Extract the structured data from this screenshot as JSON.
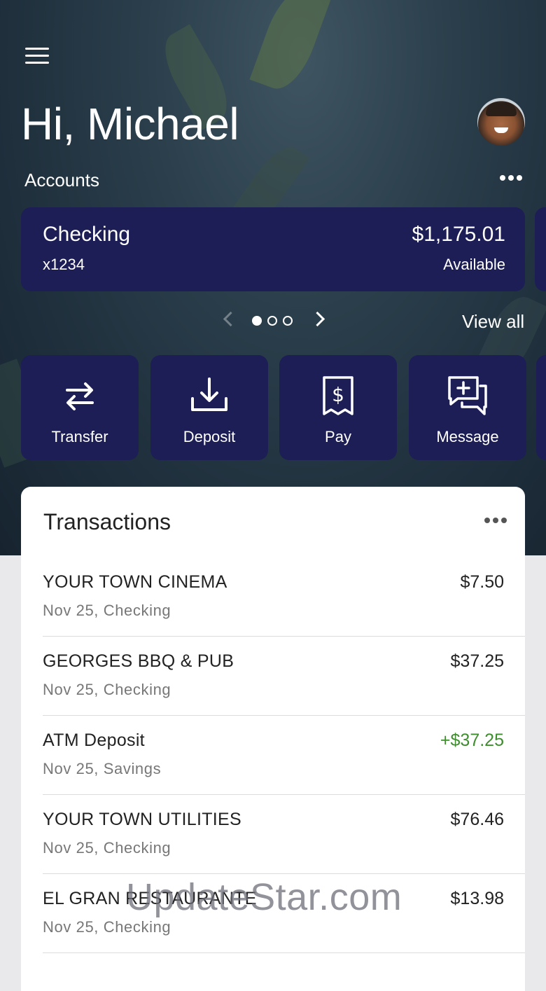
{
  "header": {
    "greeting": "Hi, Michael",
    "accounts_label": "Accounts"
  },
  "account_card": {
    "name": "Checking",
    "number": "x1234",
    "balance": "$1,175.01",
    "balance_label": "Available"
  },
  "pager": {
    "view_all": "View all",
    "pages": 3,
    "active_page": 1
  },
  "actions": [
    {
      "label": "Transfer",
      "icon": "transfer-arrows-icon"
    },
    {
      "label": "Deposit",
      "icon": "download-tray-icon"
    },
    {
      "label": "Pay",
      "icon": "dollar-receipt-icon"
    },
    {
      "label": "Message",
      "icon": "message-plus-icon"
    }
  ],
  "transactions": {
    "title": "Transactions",
    "items": [
      {
        "name": "YOUR TOWN CINEMA",
        "sub": "Nov 25, Checking",
        "amount": "$7.50",
        "credit": false
      },
      {
        "name": "GEORGES BBQ & PUB",
        "sub": "Nov 25, Checking",
        "amount": "$37.25",
        "credit": false
      },
      {
        "name": "ATM Deposit",
        "sub": "Nov 25, Savings",
        "amount": "+$37.25",
        "credit": true
      },
      {
        "name": "YOUR TOWN UTILITIES",
        "sub": "Nov 25, Checking",
        "amount": "$76.46",
        "credit": false
      },
      {
        "name": "EL GRAN RESTAURANTE",
        "sub": "Nov 25, Checking",
        "amount": "$13.98",
        "credit": false
      }
    ]
  },
  "watermark": "UpdateStar.com",
  "colors": {
    "card": "#1c1e55",
    "credit": "#3e8e2e"
  }
}
